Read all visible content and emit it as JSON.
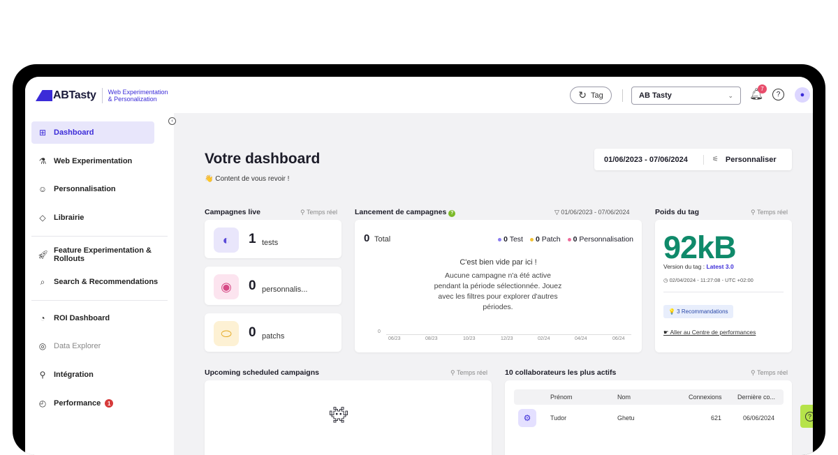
{
  "brand": {
    "name": "ABTasty",
    "sub_line1": "Web Experimentation",
    "sub_line2": "& Personalization",
    "accent": "#3b2bd8"
  },
  "topbar": {
    "tag_label": "Tag",
    "account": "AB Tasty",
    "notifications": "7",
    "help_icon": "help-circle-icon",
    "avatar_icon": "user-icon"
  },
  "sidebar": {
    "items": [
      {
        "label": "Dashboard",
        "icon": "grid-icon",
        "active": true
      },
      {
        "label": "Web Experimentation",
        "icon": "flask-icon"
      },
      {
        "label": "Personnalisation",
        "icon": "person-icon"
      },
      {
        "label": "Librairie",
        "icon": "puzzle-icon"
      },
      {
        "label": "Feature Experimentation &",
        "label2": "Rollouts",
        "icon": "rocket-icon"
      },
      {
        "label": "Search & Recommendations",
        "icon": "search-icon"
      },
      {
        "label": "ROI Dashboard",
        "icon": "pie-chart-icon"
      },
      {
        "label": "Data Explorer",
        "icon": "explore-icon"
      },
      {
        "label": "Intégration",
        "icon": "integration-icon"
      },
      {
        "label": "Performance",
        "icon": "gauge-icon",
        "badge": "1"
      }
    ]
  },
  "header": {
    "title": "Votre dashboard",
    "welcome": "👋 Content de vous revoir !",
    "date_range": "01/06/2023 - 07/06/2024",
    "customize": "Personnaliser"
  },
  "live_campaigns": {
    "title": "Campagnes live",
    "realtime": "Temps réel",
    "cards": [
      {
        "count": "1",
        "label": "tests",
        "icon": "split-icon",
        "color": "#e9e6fb"
      },
      {
        "count": "0",
        "label": "personnalis...",
        "icon": "target-person-icon",
        "color": "#fce4ef"
      },
      {
        "count": "0",
        "label": "patchs",
        "icon": "bandage-icon",
        "color": "#fdf1d4"
      }
    ]
  },
  "launch": {
    "title": "Lancement de campagnes",
    "date_filter": "01/06/2023 - 07/06/2024",
    "total_value": "0",
    "total_label": "Total",
    "legend": [
      {
        "value": "0",
        "label": "Test",
        "color": "#8a7cf0"
      },
      {
        "value": "0",
        "label": "Patch",
        "color": "#f2c233"
      },
      {
        "value": "0",
        "label": "Personnalisation",
        "color": "#ee6b9a"
      }
    ],
    "empty_title": "C'est bien vide par ici !",
    "empty_body": "Aucune campagne n'a été active pendant la période sélectionnée. Jouez avec les filtres pour explorer d'autres périodes.",
    "y_zero": "0",
    "ticks": [
      "06/23",
      "08/23",
      "10/23",
      "12/23",
      "02/24",
      "04/24",
      "06/24"
    ]
  },
  "tag_weight": {
    "title": "Poids du tag",
    "realtime": "Temps réel",
    "value": "92kB",
    "version_label": "Version du tag :",
    "version": "Latest 3.0",
    "date": "02/04/2024 - 11:27:08 - UTC +02:00",
    "recommendations": "💡 3 Recommandations",
    "perf_link": "Aller au Centre de performances"
  },
  "upcoming": {
    "title": "Upcoming scheduled campaigns",
    "realtime": "Temps réel"
  },
  "collaborators": {
    "title": "10 collaborateurs les plus actifs",
    "realtime": "Temps réel",
    "columns": [
      "Prénom",
      "Nom",
      "Connexions",
      "Dernière co..."
    ],
    "rows": [
      {
        "first": "Tudor",
        "last": "Ghetu",
        "connections": "621",
        "last_seen": "06/06/2024"
      }
    ]
  }
}
